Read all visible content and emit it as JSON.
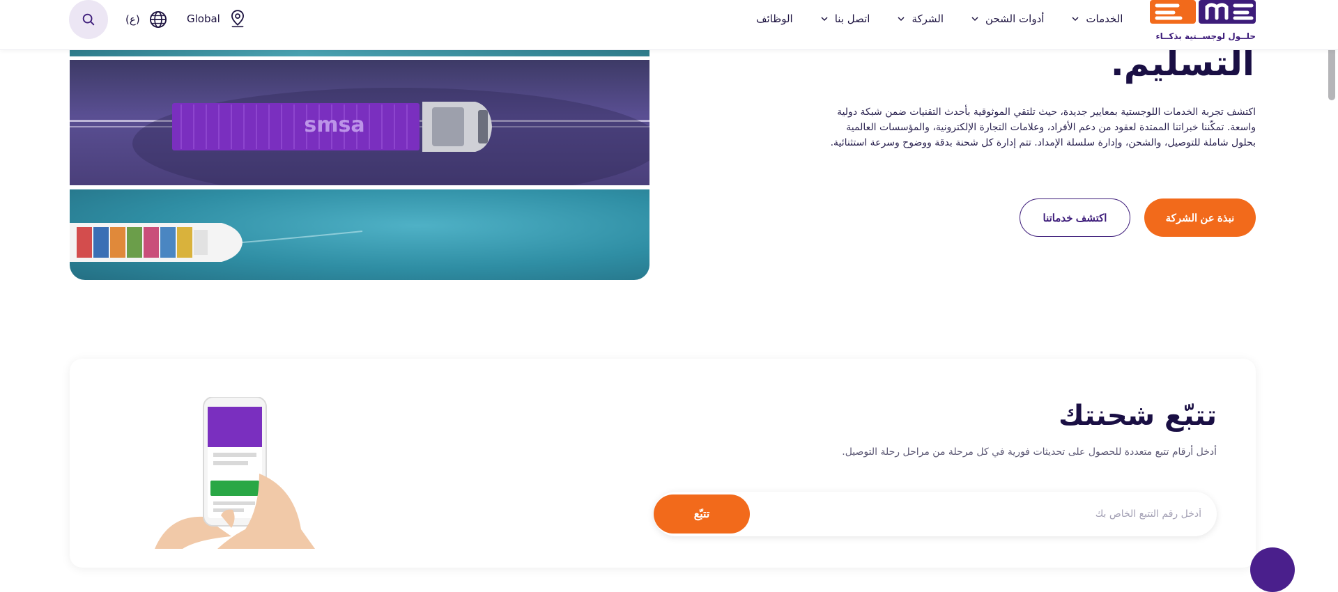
{
  "header": {
    "language_label": "(ع)",
    "region_label": "Global",
    "logo_tagline": "حلــول لوجســتية بذكــاء",
    "nav": [
      {
        "label": "الخدمات",
        "has_dropdown": true
      },
      {
        "label": "أدوات الشحن",
        "has_dropdown": true
      },
      {
        "label": "الشركة",
        "has_dropdown": true
      },
      {
        "label": "اتصل بنا",
        "has_dropdown": true
      },
      {
        "label": "الوظائف",
        "has_dropdown": false
      }
    ]
  },
  "hero": {
    "title": "التسليم.",
    "description": "اكتشف تجربة الخدمات اللوجستية بمعايير جديدة، حيث تلتقي الموثوقية بأحدث التقنيات ضمن شبكة دولية واسعة. تمكّننا خبراتنا الممتدة لعقود من دعم الأفراد، وعلامات التجارة الإلكترونية، والمؤسسات العالمية بحلول شاملة للتوصيل، والشحن، وإدارة سلسلة الإمداد. تتم إدارة كل شحنة بدقة ووضوح وسرعة استثنائية.",
    "primary_button": "نبذة عن الشركة",
    "secondary_button": "اكتشف خدماتنا",
    "container_brand_text": "smsa"
  },
  "tracking": {
    "title": "تتبّع شحنتك",
    "subtitle": "أدخل أرقام تتبع متعددة للحصول على تحديثات فورية في كل مرحلة من مراحل رحلة التوصيل.",
    "input_placeholder": "أدخل رقم التتبع الخاص بك",
    "input_value": "",
    "button_label": "تتبّع"
  },
  "colors": {
    "brand_purple": "#3d1c7a",
    "brand_orange": "#f26a1b",
    "heading_dark": "#1a0f44",
    "search_bg": "#ece6f4"
  },
  "icons": {
    "search": "search-icon",
    "globe": "globe-icon",
    "location": "location-pin-icon",
    "chevron": "chevron-down-icon"
  }
}
